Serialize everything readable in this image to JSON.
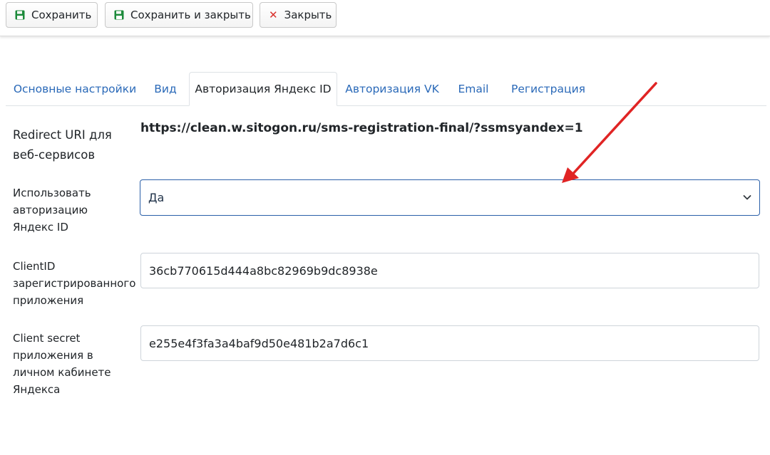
{
  "toolbar": {
    "save_label": "Сохранить",
    "save_close_label": "Сохранить и закрыть",
    "close_label": "Закрыть"
  },
  "tabs": [
    {
      "label": "Основные настройки",
      "active": false
    },
    {
      "label": "Вид",
      "active": false
    },
    {
      "label": "Авторизация Яндекс ID",
      "active": true
    },
    {
      "label": "Авторизация VK",
      "active": false
    },
    {
      "label": "Email",
      "active": false
    },
    {
      "label": "Регистрация",
      "active": false
    }
  ],
  "form": {
    "redirect": {
      "label_line1": "Redirect URI для",
      "label_line2": "веб-сервисов",
      "value": "https://clean.w.sitogon.ru/sms-registration-final/?ssmsyandex=1"
    },
    "use_yandex": {
      "label_line1": "Использовать",
      "label_line2": "авторизацию",
      "label_line3": "Яндекс ID",
      "value": "Да"
    },
    "client_id": {
      "label_line1": "ClientID",
      "label_line2": "зарегистрированного",
      "label_line3": "приложения",
      "value": "36cb770615d444a8bc82969b9dc8938e"
    },
    "client_secret": {
      "label_line1": "Client secret",
      "label_line2": "приложения в",
      "label_line3": "личном кабинете",
      "label_line4": "Яндекса",
      "value": "e255e4f3fa3a4baf9d50e481b2a7d6c1"
    }
  },
  "colors": {
    "save_icon": "#1c8a3a",
    "close_icon": "#d9302b",
    "tab_link": "#2a69b8",
    "select_border": "#2a5fa8",
    "annotation_arrow": "#e02424"
  },
  "icons": {
    "save": "floppy-disk-icon",
    "close": "close-x-icon",
    "select": "chevron-down-icon",
    "annotation": "red-arrow-icon"
  }
}
